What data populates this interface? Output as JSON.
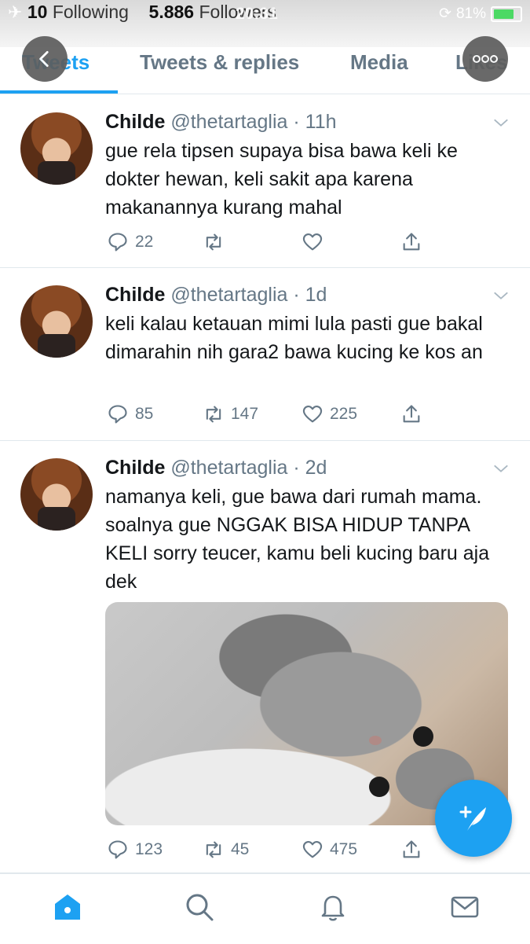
{
  "status_bar": {
    "following_count": "10",
    "following_label": "Following",
    "followers_count": "5.886",
    "followers_label": "Followers",
    "time": "20:31",
    "battery": "81%"
  },
  "tabs": [
    {
      "label": "Tweets",
      "active": true
    },
    {
      "label": "Tweets & replies",
      "active": false
    },
    {
      "label": "Media",
      "active": false
    },
    {
      "label": "Likes",
      "active": false
    }
  ],
  "tweets": [
    {
      "name": "Childe",
      "handle": "@thetartaglia",
      "time": "11h",
      "text": "gue rela tipsen supaya bisa bawa keli ke dokter hewan, keli sakit apa karena makanannya kurang mahal",
      "replies": "22",
      "retweets": "",
      "likes": ""
    },
    {
      "name": "Childe",
      "handle": "@thetartaglia",
      "time": "1d",
      "text": "keli kalau ketauan mimi lula pasti gue bakal dimarahin nih gara2 bawa kucing ke kos an",
      "replies": "85",
      "retweets": "147",
      "likes": "225"
    },
    {
      "name": "Childe",
      "handle": "@thetartaglia",
      "time": "2d",
      "text": "namanya keli, gue bawa dari rumah mama. soalnya gue NGGAK BISA HIDUP TANPA KELI sorry teucer, kamu beli kucing baru aja dek",
      "replies": "123",
      "retweets": "45",
      "likes": "475",
      "has_photo": true
    }
  ],
  "colors": {
    "accent": "#1da1f2",
    "meta": "#657786",
    "border": "#e1e8ed"
  },
  "icons": [
    "back-arrow-icon",
    "more-icon",
    "reply-icon",
    "retweet-icon",
    "like-icon",
    "share-icon",
    "chevron-down-icon",
    "compose-icon",
    "home-icon",
    "search-icon",
    "notifications-icon",
    "messages-icon"
  ]
}
